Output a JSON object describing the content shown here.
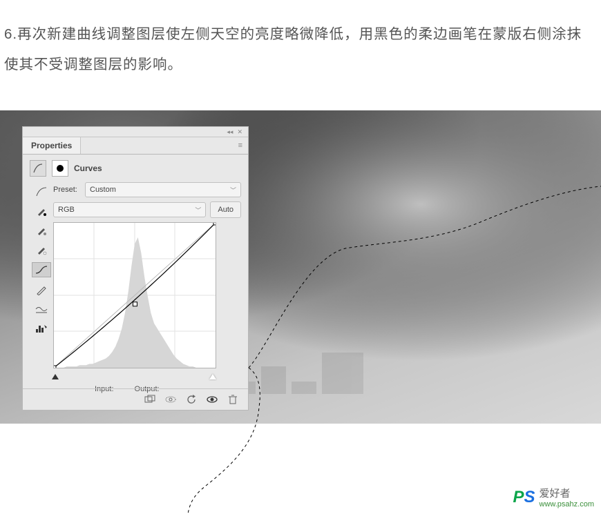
{
  "instruction_text": "6.再次新建曲线调整图层使左侧天空的亮度略微降低，用黑色的柔边画笔在蒙版右侧涂抹使其不受调整图层的影响。",
  "panel": {
    "tab": "Properties",
    "adj_name": "Curves",
    "preset_label": "Preset:",
    "preset_value": "Custom",
    "channel_value": "RGB",
    "auto_label": "Auto",
    "input_label": "Input:",
    "output_label": "Output:",
    "tool_icons": [
      "curve-preset-icon",
      "eyedropper-black-icon",
      "eyedropper-gray-icon",
      "eyedropper-white-icon",
      "point-curve-icon",
      "pencil-curve-icon",
      "smooth-icon",
      "histogram-icon"
    ],
    "footer_icons": [
      "clip-icon",
      "eye-icon",
      "reset-icon",
      "visibility-icon",
      "trash-icon"
    ]
  },
  "chart_data": {
    "type": "line",
    "title": "Curves",
    "xlabel": "Input",
    "ylabel": "Output",
    "xlim": [
      0,
      255
    ],
    "ylim": [
      0,
      255
    ],
    "points": [
      {
        "x": 0,
        "y": 0
      },
      {
        "x": 128,
        "y": 112
      },
      {
        "x": 255,
        "y": 255
      }
    ],
    "histogram_bins": [
      0,
      0,
      0,
      0,
      1,
      1,
      1,
      1,
      2,
      2,
      2,
      3,
      3,
      4,
      5,
      6,
      7,
      9,
      12,
      16,
      22,
      30,
      42,
      58,
      78,
      95,
      100,
      88,
      70,
      55,
      42,
      34,
      30,
      26,
      22,
      18,
      14,
      10,
      7,
      5,
      3,
      2,
      1,
      1,
      0,
      0,
      0,
      0,
      0,
      0
    ],
    "grid": true
  },
  "credit": {
    "logo_p": "P",
    "logo_s": "S",
    "cn": "爱好者",
    "url": "www.psahz.com"
  }
}
